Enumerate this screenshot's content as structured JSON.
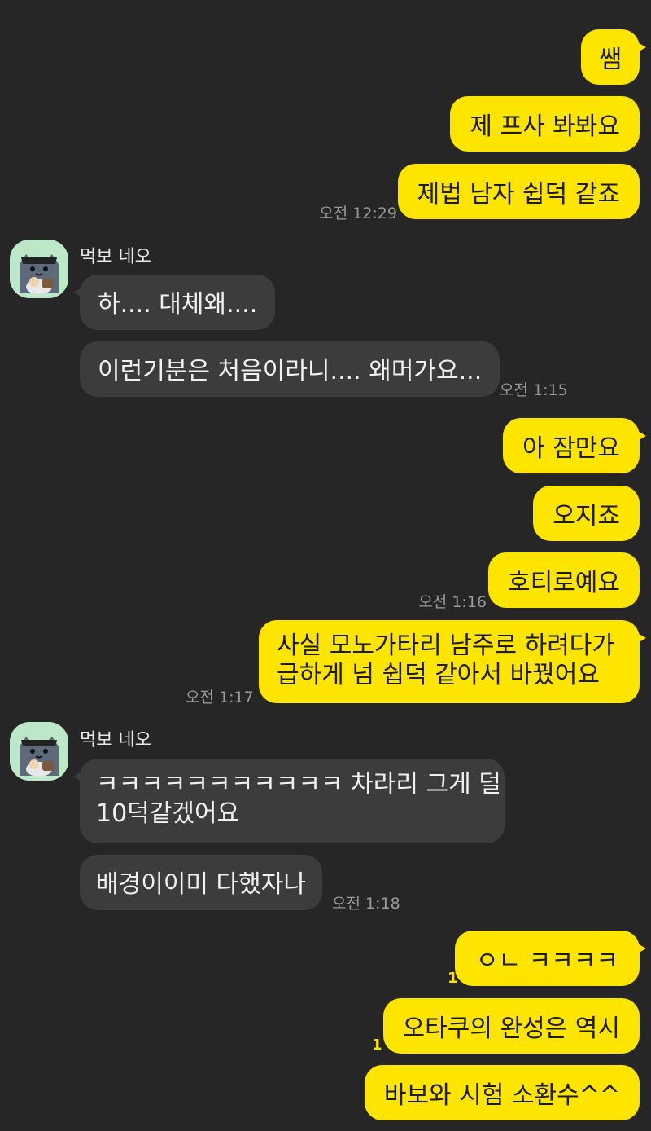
{
  "colors": {
    "background": "#262626",
    "my_bubble": "#FEE500",
    "other_bubble": "#3C3C3C",
    "timestamp": "#9a9a9a",
    "unread": "#FEE500",
    "avatar_bg": "#BDE8C8"
  },
  "sender_name": "먹보 네오",
  "avatar_icon": "cat-character-avatar-icon",
  "messages": {
    "m1": "쌤",
    "m2": "제 프사 봐봐요",
    "m3": "제법 남자 쉽덕 같죠",
    "t1": "오전 12:29",
    "o1": "하.... 대체왜....",
    "o2": "이런기분은 처음이라니.... 왜머가요...",
    "t2": "오전 1:15",
    "m4": "아 잠만요",
    "m5": "오지죠",
    "m6": "호티로예요",
    "t3": "오전 1:16",
    "m7_line1": "사실 모노가타리 남주로 하려다가",
    "m7_line2": "급하게 넘 쉽덕 같아서 바꿨어요",
    "t4": "오전 1:17",
    "o3_line1": "ㅋㅋㅋㅋㅋㅋㅋㅋㅋㅋㅋ 차라리 그게 덜",
    "o3_line2": "10덕같겠어요",
    "o4": "배경이이미 다했자나",
    "t5": "오전 1:18",
    "m8": "ㅇㄴ ㅋㅋㅋㅋ",
    "m9": "오타쿠의 완성은 역시",
    "m10": "바보와 시험 소환수^^",
    "unread_count": "1"
  }
}
